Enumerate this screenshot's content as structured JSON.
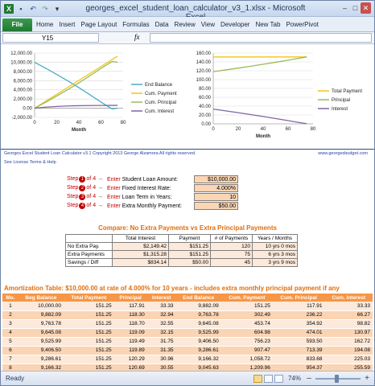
{
  "window": {
    "title": "georges_excel_student_loan_calculator_v3_1.xlsx - Microsoft Excel",
    "icons": [
      "excel-icon",
      "save-icon",
      "undo-icon",
      "redo-icon",
      "customize-icon"
    ],
    "buttons": {
      "minimize": "–",
      "maximize": "□",
      "close": "✕"
    }
  },
  "ribbon": {
    "file_tab": "File",
    "tabs": [
      "Home",
      "Insert",
      "Page Layout",
      "Formulas",
      "Data",
      "Review",
      "View",
      "Developer",
      "New Tab",
      "PowerPivot"
    ]
  },
  "formula_bar": {
    "name_box": "Y15",
    "fx": "fx",
    "content": ""
  },
  "chart_data": [
    {
      "type": "line",
      "title": "",
      "xlabel": "Month",
      "ylabel": "",
      "xlim": [
        0,
        80
      ],
      "ylim": [
        -2000,
        12000
      ],
      "x_ticks": [
        "0",
        "20",
        "40",
        "60",
        "80"
      ],
      "y_ticks": [
        "12,000.00",
        "10,000.00",
        "8,000.00",
        "6,000.00",
        "4,000.00",
        "2,000.00",
        "0.00",
        "-2,000.00"
      ],
      "x": [
        0,
        10,
        20,
        30,
        40,
        50,
        60,
        70,
        75
      ],
      "series": [
        {
          "name": "End Balance",
          "color": "#4bacc6",
          "values": [
            10000,
            8710,
            7360,
            5950,
            4480,
            2940,
            1340,
            -160,
            0
          ]
        },
        {
          "name": "Cum. Payment",
          "color": "#f2c21a",
          "values": [
            0,
            1510,
            3020,
            4540,
            6050,
            7560,
            9070,
            10590,
            11340
          ]
        },
        {
          "name": "Cum. Principal",
          "color": "#9bbb59",
          "values": [
            0,
            1290,
            2640,
            4050,
            5520,
            7060,
            8660,
            10160,
            10000
          ]
        },
        {
          "name": "Cum. Interest",
          "color": "#8064a2",
          "values": [
            0,
            230,
            380,
            490,
            550,
            580,
            600,
            610,
            615
          ]
        }
      ]
    },
    {
      "type": "line",
      "title": "",
      "xlabel": "Month",
      "ylabel": "",
      "xlim": [
        0,
        80
      ],
      "ylim": [
        0,
        160
      ],
      "x_ticks": [
        "0",
        "20",
        "40",
        "60",
        "80"
      ],
      "y_ticks": [
        "160.00",
        "140.00",
        "120.00",
        "100.00",
        "80.00",
        "60.00",
        "40.00",
        "20.00",
        "0.00"
      ],
      "x": [
        0,
        10,
        20,
        30,
        40,
        50,
        60,
        70,
        75
      ],
      "series": [
        {
          "name": "Total Payment",
          "color": "#f2c21a",
          "values": [
            151.25,
            151.25,
            151.25,
            151.25,
            151.25,
            151.25,
            151.25,
            151.25,
            151.25
          ]
        },
        {
          "name": "Principal",
          "color": "#9bbb59",
          "values": [
            117.91,
            121.9,
            126.0,
            130.3,
            134.7,
            139.2,
            143.9,
            148.8,
            151.25
          ]
        },
        {
          "name": "Interest",
          "color": "#8064a2",
          "values": [
            33.33,
            29.35,
            25.2,
            20.95,
            16.55,
            12.05,
            7.35,
            2.45,
            0.2
          ]
        }
      ]
    }
  ],
  "sheet": {
    "footer_left": "Georges Excel Student Loan Calculator v3.1     Copyright 2013  George Alzamora  All rights reserved.",
    "footer_right": "www.georgesbudget.com",
    "license": "See License Terms & Help",
    "inputs": [
      {
        "step": "1",
        "label": "Student Loan Amount:",
        "value": "$10,000.00"
      },
      {
        "step": "2",
        "label": "Fixed Interest Rate:",
        "value": "4.000%"
      },
      {
        "step": "3",
        "label": "Loan Term in Years:",
        "value": "10"
      },
      {
        "step": "4",
        "label": "Extra Monthly Payment:",
        "value": "$50.00"
      }
    ],
    "step_prefix": "Step",
    "step_suffix": "of 4 →",
    "enter_word": "Enter",
    "compare": {
      "title": "Compare: No Extra Payments vs Extra Principal Payments",
      "headers": [
        "",
        "Total Interest",
        "Payment",
        "# of Payments",
        "Years / Months"
      ],
      "rows": [
        [
          "No Extra Pay.",
          "$2,149.42",
          "$151.25",
          "120",
          "10 yrs 0 mos"
        ],
        [
          "Extra Payments",
          "$1,315.28",
          "$151.25",
          "75",
          "6 yrs 3 mos"
        ],
        [
          "Savings / Diff",
          "$834.14",
          "$50.00",
          "45",
          "3 yrs 9 mos"
        ]
      ]
    },
    "amortization": {
      "title": "Amortization Table:  $10,000.00 at rate of 4.000% for 10 years - includes extra monthly principal payment if any",
      "headers": [
        "Mo.",
        "Beg Balance",
        "Total Payment",
        "Principal",
        "Interest",
        "End Balance",
        "Cum. Payment",
        "Cum. Principal",
        "Cum. Interest"
      ],
      "rows": [
        [
          "1",
          "10,000.00",
          "151.25",
          "117.91",
          "33.33",
          "9,882.09",
          "151.25",
          "117.91",
          "33.33"
        ],
        [
          "2",
          "9,882.09",
          "151.25",
          "118.30",
          "32.94",
          "9,763.78",
          "302.49",
          "236.22",
          "66.27"
        ],
        [
          "3",
          "9,763.78",
          "151.25",
          "118.70",
          "32.55",
          "9,645.08",
          "453.74",
          "354.92",
          "98.82"
        ],
        [
          "4",
          "9,645.08",
          "151.25",
          "119.09",
          "32.15",
          "9,525.99",
          "604.98",
          "474.01",
          "130.97"
        ],
        [
          "5",
          "9,525.99",
          "151.25",
          "119.49",
          "31.75",
          "9,406.50",
          "756.23",
          "593.50",
          "162.72"
        ],
        [
          "6",
          "9,406.50",
          "151.25",
          "119.89",
          "31.35",
          "9,286.61",
          "907.47",
          "713.39",
          "194.08"
        ],
        [
          "7",
          "9,286.61",
          "151.25",
          "120.29",
          "30.96",
          "9,166.32",
          "1,058.72",
          "833.68",
          "225.03"
        ],
        [
          "8",
          "9,166.32",
          "151.25",
          "120.69",
          "30.55",
          "9,045.63",
          "1,209.96",
          "954.37",
          "255.59"
        ]
      ]
    }
  },
  "status": {
    "ready": "Ready",
    "zoom": "74%",
    "minus": "–",
    "plus": "+"
  }
}
